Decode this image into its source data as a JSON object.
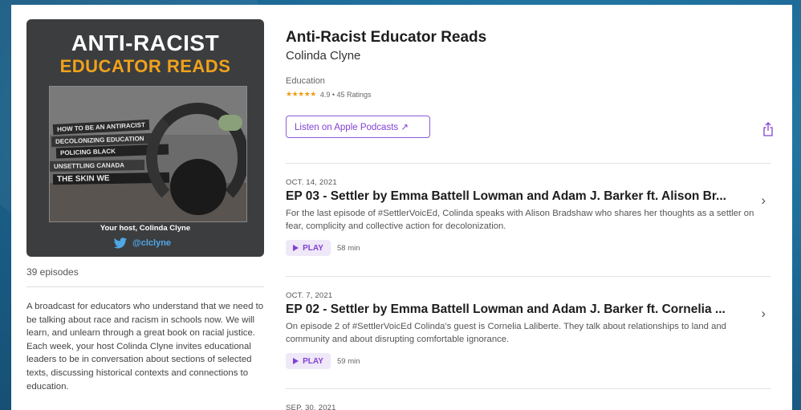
{
  "artwork": {
    "title_line1": "ANTI-RACIST",
    "title_line2": "EDUCATOR READS",
    "books": [
      "HOW TO BE AN ANTIRACIST",
      "DECOLONIZING EDUCATION",
      "POLICING BLACK",
      "UNSETTLING CANADA",
      "THE SKIN WE"
    ],
    "host": "Your host, Colinda Clyne",
    "twitter": "@clclyne"
  },
  "podcast": {
    "title": "Anti-Racist Educator Reads",
    "author": "Colinda Clyne",
    "genre": "Education",
    "stars": "★★★★★",
    "rating": "4.9 • 45 Ratings",
    "listen_label": "Listen on Apple Podcasts ↗",
    "episode_count": "39 episodes",
    "description": "A broadcast for educators who understand that we need to be talking about race and racism in schools now. We will learn, and unlearn through a great book on racial justice. Each week, your host Colinda Clyne invites educational leaders to be in conversation about sections of selected texts, discussing historical contexts and connections to education."
  },
  "episodes": [
    {
      "date": "OCT. 14, 2021",
      "title": "EP 03 - Settler by Emma Battell Lowman and Adam J. Barker ft. Alison Br...",
      "description": "For the last episode of #SettlerVoicEd, Colinda speaks with Alison Bradshaw who shares her thoughts as a settler on fear, complicity and collective action for decolonization.",
      "play_label": "PLAY",
      "duration": "58 min"
    },
    {
      "date": "OCT. 7, 2021",
      "title": "EP 02 - Settler by Emma Battell Lowman and Adam J. Barker ft. Cornelia ...",
      "description": "On episode 2 of #SettlerVoicEd Colinda's guest is Cornelia Laliberte. They talk about relationships to land and community and about disrupting comfortable ignorance.",
      "play_label": "PLAY",
      "duration": "59 min"
    },
    {
      "date": "SEP. 30, 2021"
    }
  ],
  "colors": {
    "accent": "#8240d6",
    "star": "#f39c12",
    "artwork_bg": "#3c3d3f",
    "artwork_orange": "#f0a21b"
  }
}
